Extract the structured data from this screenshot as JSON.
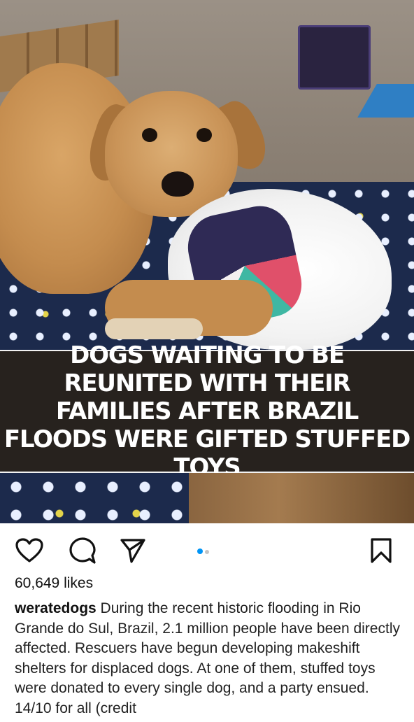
{
  "post": {
    "image_overlay_text": "DOGS WAITING TO BE REUNITED WITH THEIR FAMILIES AFTER BRAZIL FLOODS WERE GIFTED STUFFED TOYS",
    "image_alt": "Tan dog lying on a polka-dot bed holding a white stuffed toy"
  },
  "actions": {
    "like_icon": "heart-icon",
    "comment_icon": "comment-bubble-icon",
    "share_icon": "paper-plane-icon",
    "save_icon": "bookmark-icon",
    "carousel": {
      "total": 2,
      "active": 1
    }
  },
  "likes": "60,649 likes",
  "caption": {
    "username": "weratedogs",
    "text": "During the recent historic flooding in Rio Grande do Sul, Brazil, 2.1 million people have been directly affected. Rescuers have begun developing makeshift shelters for displaced dogs. At one of them, stuffed toys were donated to every single dog, and a party ensued. 14/10 for all (credit"
  },
  "colors": {
    "accent_dot": "#0095f6",
    "banner_bg": "#27221e"
  }
}
